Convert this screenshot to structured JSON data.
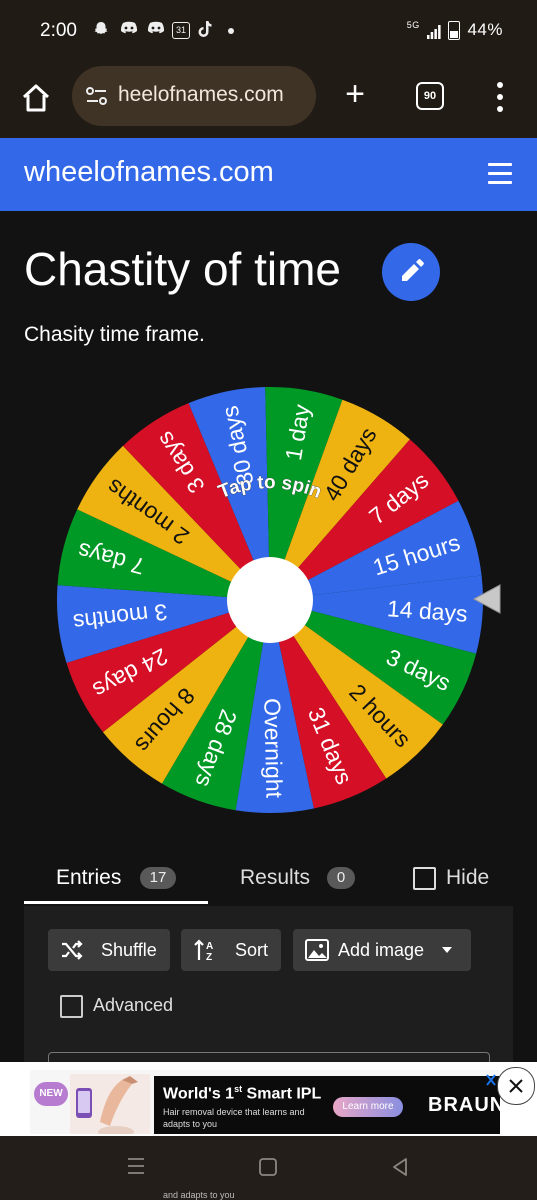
{
  "status_bar": {
    "time": "2:00",
    "network": "5G",
    "battery": "44%",
    "notification_icons": [
      "snapchat-icon",
      "discord-icon",
      "discord-icon",
      "calendar-icon",
      "tiktok-icon",
      "more-dot-icon"
    ],
    "calendar_day": "31"
  },
  "browser": {
    "url": "heelofnames.com",
    "tab_count": "90"
  },
  "site": {
    "logo": "wheelofnames.com"
  },
  "page": {
    "title": "Chastity of time",
    "description": "Chasity time frame."
  },
  "wheel": {
    "center_text": "Tap to spin",
    "colors": [
      "#3369e8",
      "#009925",
      "#eeb211",
      "#d50f25"
    ],
    "segments": [
      "14 days",
      "3 days",
      "2 hours",
      "31 days",
      "Overnight",
      "28 days",
      "8 hours",
      "24 days",
      "3 months",
      "7 days",
      "2 months",
      "3 days",
      "30 days",
      "1 day",
      "40 days",
      "7 days",
      "15 hours"
    ]
  },
  "tabs": {
    "entries_label": "Entries",
    "entries_count": "17",
    "results_label": "Results",
    "results_count": "0",
    "hide_label": "Hide"
  },
  "toolbar": {
    "shuffle_label": "Shuffle",
    "sort_label": "Sort",
    "add_image_label": "Add image",
    "advanced_label": "Advanced"
  },
  "ad": {
    "badge": "NEW",
    "headline_pre": "World's 1",
    "headline_sup": "st",
    "headline_post": " Smart IPL",
    "subtext": "Hair removal device that learns and adapts to you",
    "cta": "Learn more",
    "brand": "BRAUN",
    "peek_text": "and adapts to you"
  }
}
